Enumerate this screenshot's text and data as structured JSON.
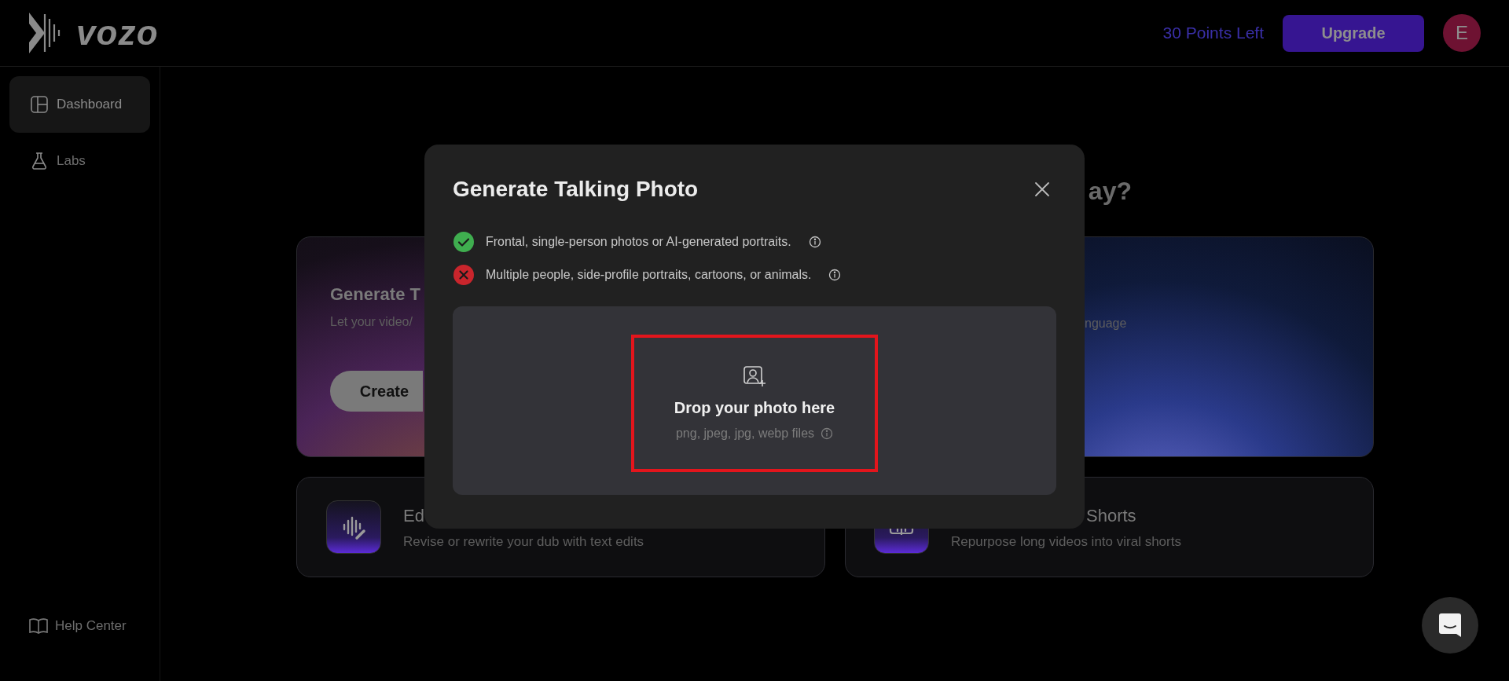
{
  "header": {
    "logo": "vozo",
    "points": "30 Points Left",
    "upgrade": "Upgrade",
    "avatar": "E"
  },
  "sidebar": {
    "items": [
      {
        "label": "Dashboard",
        "selected": true
      },
      {
        "label": "Labs",
        "selected": false
      }
    ],
    "footer": {
      "label": "Help Center"
    }
  },
  "main": {
    "heading": "ay?",
    "top_cards": [
      {
        "title": "Generate T",
        "subtitle": "Let your video/",
        "button": "Create"
      },
      {
        "subtitle": "nguage"
      }
    ],
    "bottom_cards": [
      {
        "title": "Ed",
        "subtitle": "Revise or rewrite your dub with text edits"
      },
      {
        "title": "Shorts",
        "subtitle": "Repurpose long videos into viral shorts"
      }
    ]
  },
  "modal": {
    "title": "Generate Talking Photo",
    "rules": [
      {
        "kind": "allowed",
        "text": "Frontal, single-person photos or AI-generated portraits."
      },
      {
        "kind": "rejected",
        "text": "Multiple people, side-profile portraits, cartoons, or animals."
      }
    ],
    "dropzone": {
      "title": "Drop your photo here",
      "hint": "png, jpeg, jpg, webp files",
      "highlighted": true
    }
  }
}
